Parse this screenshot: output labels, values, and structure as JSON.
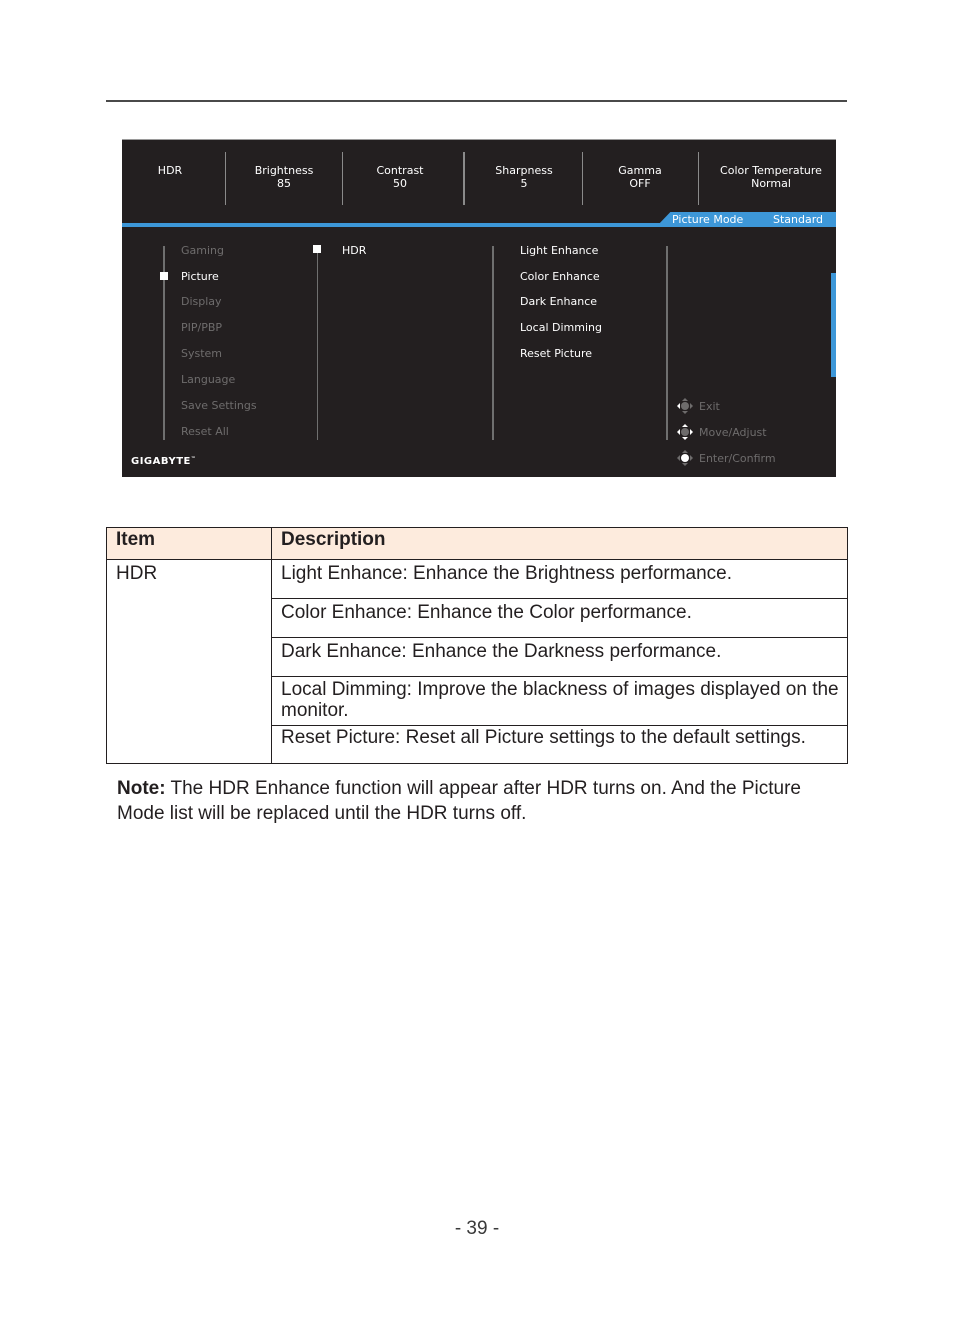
{
  "osd": {
    "header": [
      {
        "label": "HDR",
        "value": ""
      },
      {
        "label": "Brightness",
        "value": "85"
      },
      {
        "label": "Contrast",
        "value": "50"
      },
      {
        "label": "Sharpness",
        "value": "5"
      },
      {
        "label": "Gamma",
        "value": "OFF"
      },
      {
        "label": "Color Temperature",
        "value": "Normal"
      }
    ],
    "picture_mode": {
      "label": "Picture Mode",
      "value": "Standard"
    },
    "main_menu": [
      {
        "label": "Gaming",
        "active": false
      },
      {
        "label": "Picture",
        "active": true
      },
      {
        "label": "Display",
        "active": false
      },
      {
        "label": "PIP/PBP",
        "active": false
      },
      {
        "label": "System",
        "active": false
      },
      {
        "label": "Language",
        "active": false
      },
      {
        "label": "Save Settings",
        "active": false
      },
      {
        "label": "Reset All",
        "active": false
      }
    ],
    "sub_menu": [
      {
        "label": "HDR",
        "active": true
      }
    ],
    "options": [
      "Light Enhance",
      "Color Enhance",
      "Dark Enhance",
      "Local Dimming",
      "Reset Picture"
    ],
    "hints": [
      {
        "icon": "joystick-left-icon",
        "label": "Exit"
      },
      {
        "icon": "joystick-updown-icon",
        "label": "Move/Adjust"
      },
      {
        "icon": "joystick-press-icon",
        "label": "Enter/Confirm"
      }
    ],
    "brand": "GIGABYTE",
    "brand_tm": "™",
    "accent_color": "#3d97d8"
  },
  "table": {
    "headers": [
      "Item",
      "Description"
    ],
    "item": "HDR",
    "rows": [
      "Light Enhance: Enhance the Brightness performance.",
      "Color Enhance: Enhance the Color performance.",
      "Dark Enhance: Enhance the Darkness performance.",
      "Local Dimming: Improve the blackness of images displayed on the monitor.",
      "Reset Picture: Reset all Picture settings to the default settings."
    ],
    "header_bg": "#fdebdd"
  },
  "note": {
    "label": "Note:",
    "text": " The HDR Enhance function will appear after HDR turns on. And the Picture Mode list will be replaced until the HDR turns off."
  },
  "page_number": "- 39 -"
}
